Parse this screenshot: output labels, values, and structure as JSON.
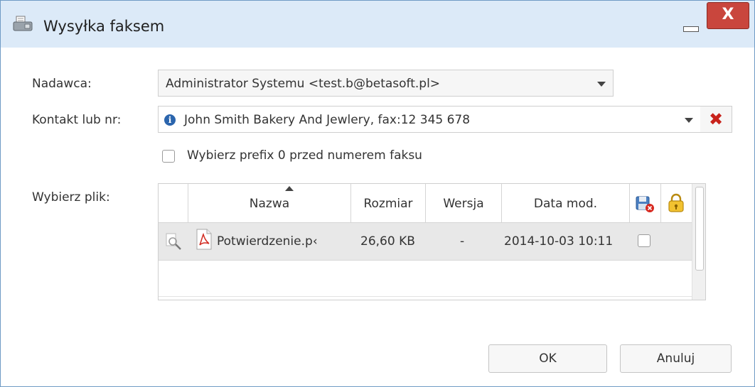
{
  "dialog": {
    "title": "Wysyłka faksem",
    "icons": {
      "title": "fax-icon",
      "minimize": "minimize-icon",
      "close": "close-icon"
    },
    "close_label": "X"
  },
  "form": {
    "sender": {
      "label": "Nadawca:",
      "value": "Administrator Systemu <test.b@betasoft.pl>"
    },
    "contact": {
      "label": "Kontakt lub nr:",
      "info_glyph": "i",
      "value": "John Smith Bakery And Jewlery, fax:12 345 678",
      "clear_glyph": "✖"
    },
    "prefix_checkbox": {
      "label": "Wybierz prefix 0 przed numerem faksu",
      "checked": false
    },
    "file_picker": {
      "label": "Wybierz plik:",
      "columns": {
        "name": "Nazwa",
        "size": "Rozmiar",
        "version": "Wersja",
        "date": "Data mod."
      },
      "sort_column": "Nazwa",
      "rows": [
        {
          "name": "Potwierdzenie.pdf",
          "name_visible": "Potwierdzenie.p‹",
          "size": "26,60 KB",
          "version": "-",
          "date": "2014-10-03 10:11",
          "checked": false
        }
      ]
    }
  },
  "footer": {
    "ok_label": "OK",
    "cancel_label": "Anuluj"
  }
}
